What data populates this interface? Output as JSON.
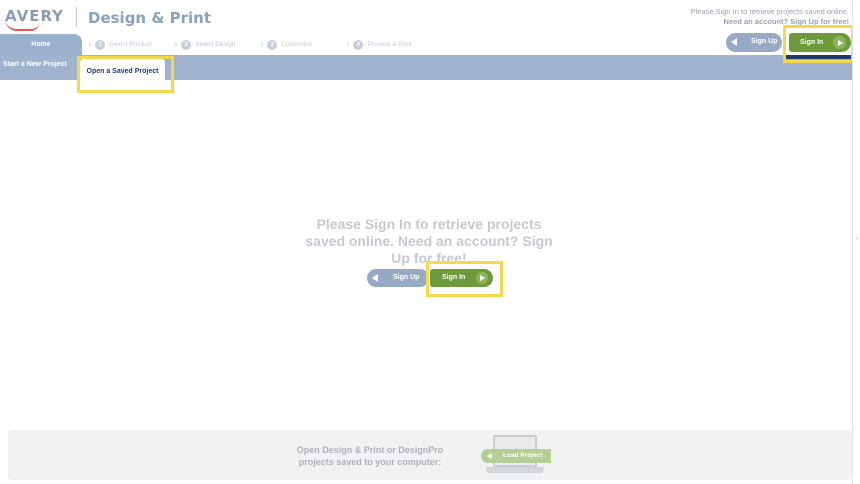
{
  "header": {
    "logo_text": "AVERY",
    "app_title": "Design & Print",
    "message_line1": "Please Sign In to retrieve projects saved online.",
    "message_need": "Need an account?",
    "message_signup": "Sign Up for free!"
  },
  "nav": {
    "home": "Home",
    "steps": [
      {
        "num": "1",
        "label": "Select Product"
      },
      {
        "num": "2",
        "label": "Select Design"
      },
      {
        "num": "3",
        "label": "Customize"
      },
      {
        "num": "4",
        "label": "Preview & Print"
      }
    ],
    "signup": "Sign Up",
    "signin": "Sign In"
  },
  "subtabs": {
    "new_project": "Start a New Project",
    "saved_project": "Open a Saved Project"
  },
  "main": {
    "message": "Please Sign In to retrieve projects saved online. Need an account? Sign Up for free!",
    "signup": "Sign Up",
    "signin": "Sign In"
  },
  "footer": {
    "text": "Open Design & Print or DesignPro projects saved to your computer:",
    "load_button": "Load Project"
  },
  "colors": {
    "nav_blue": "#9fb3ce",
    "signin_green": "#6f9a3c",
    "highlight_yellow": "#f3d94b",
    "dark_navy": "#1e3a6b"
  }
}
